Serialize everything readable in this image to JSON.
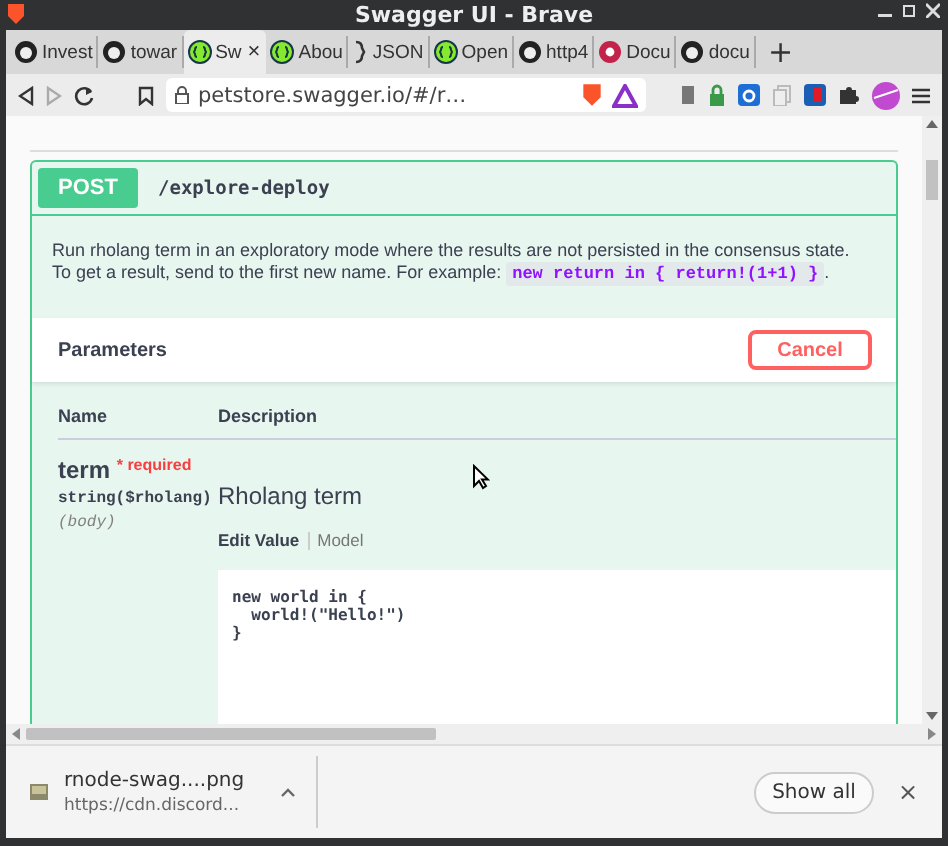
{
  "window": {
    "title": "Swagger UI - Brave"
  },
  "tabs": [
    {
      "label": "Invest",
      "kind": "github",
      "selected": false
    },
    {
      "label": "towar",
      "kind": "github",
      "selected": false
    },
    {
      "label": "Sw",
      "kind": "swagger",
      "selected": true
    },
    {
      "label": "Abou",
      "kind": "swagger",
      "selected": false
    },
    {
      "label": "JSON",
      "kind": "brace",
      "selected": false
    },
    {
      "label": "Open",
      "kind": "swagger",
      "selected": false
    },
    {
      "label": "http4",
      "kind": "github",
      "selected": false
    },
    {
      "label": "Docu",
      "kind": "wasm",
      "selected": false
    },
    {
      "label": "docu",
      "kind": "github",
      "selected": false
    }
  ],
  "new_tab": "+",
  "close_tab": "×",
  "address": "petstore.swagger.io/#/r…",
  "operation": {
    "method": "POST",
    "path": "/explore-deploy",
    "description": "Run rholang term in an exploratory mode where the results are not persisted in the consensus state.",
    "description_2": "To get a result, send to the first new name. For example: ",
    "example": "new return in { return!(1+1) }",
    "description_end": ".",
    "parameters_title": "Parameters",
    "cancel": "Cancel",
    "columns": [
      "Name",
      "Description"
    ],
    "parameter": {
      "name": "term",
      "required_mark": "*",
      "required": "required",
      "type": "string($rholang)",
      "location": "(body)",
      "description": "Rholang term",
      "tabs": [
        {
          "label": "Edit Value",
          "selected": true
        },
        {
          "label": "Model",
          "selected": false
        }
      ],
      "value": "new world in {\n  world!(\"Hello!\")\n}"
    }
  },
  "download": {
    "file": "rnode-swag....png",
    "source": "https://cdn.discord...",
    "show_all": "Show all",
    "close": "×"
  }
}
